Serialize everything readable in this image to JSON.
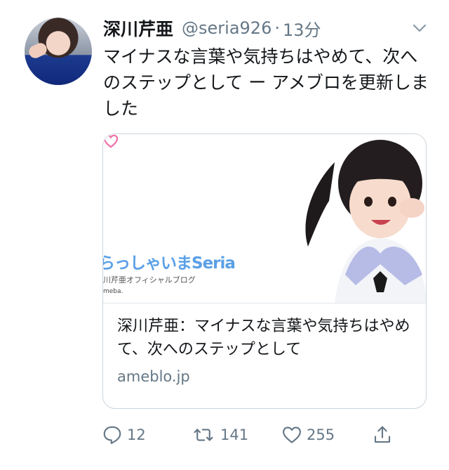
{
  "tweet": {
    "author_name": "深川芹亜",
    "handle": "@seria926",
    "separator": "·",
    "time": "13分",
    "text": "マイナスな言葉や気持ちはやめて、次へのステップとして ー アメブロを更新しました"
  },
  "card": {
    "brand_title": "らっしゃいまSeria",
    "brand_subtitle": "川芹亜オフィシャルブログ",
    "brand_ameba": "meba.",
    "title": "深川芹亜：マイナスな言葉や気持ちはやめて、次へのステップとして",
    "domain": "ameblo.jp"
  },
  "actions": {
    "reply_count": "12",
    "retweet_count": "141",
    "like_count": "255"
  },
  "icons": [
    "avatar",
    "chevron-down-icon",
    "reply-icon",
    "retweet-icon",
    "like-icon",
    "share-icon",
    "heart-icon"
  ],
  "colors": {
    "text": "#14171a",
    "secondary": "#657786",
    "border": "#ccd6dd",
    "brand_blue": "#5aa0e6",
    "heart_pink": "#f06ea9"
  }
}
